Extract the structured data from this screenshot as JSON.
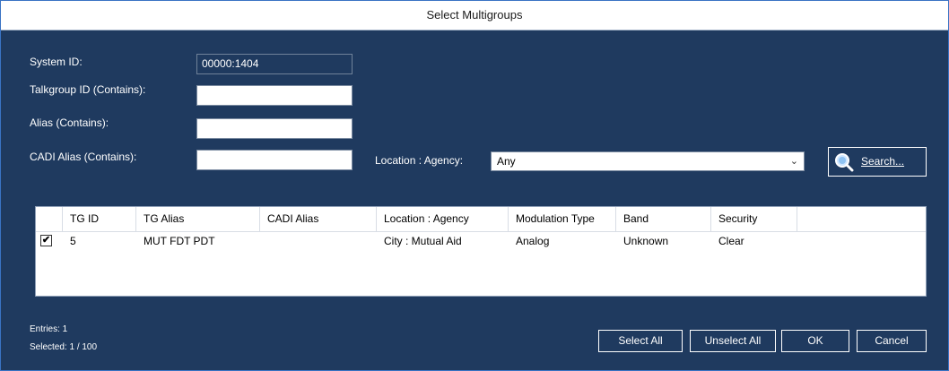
{
  "window": {
    "title": "Select Multigroups"
  },
  "form": {
    "system_id_label": "System ID:",
    "system_id_value": "00000:1404",
    "talkgroup_label": "Talkgroup ID (Contains):",
    "talkgroup_value": "",
    "alias_label": "Alias (Contains):",
    "alias_value": "",
    "cadi_label": "CADI Alias (Contains):",
    "cadi_value": "",
    "location_label": "Location : Agency:",
    "location_selected": "Any",
    "search_label": "Search..."
  },
  "grid": {
    "columns": [
      "TG ID",
      "TG Alias",
      "CADI Alias",
      "Location : Agency",
      "Modulation Type",
      "Band",
      "Security"
    ],
    "rows": [
      {
        "checked": true,
        "tg_id": "5",
        "tg_alias": "MUT FDT PDT",
        "cadi_alias": "",
        "location": "City : Mutual Aid",
        "modulation": "Analog",
        "band": "Unknown",
        "security": "Clear"
      }
    ]
  },
  "status": {
    "entries": "Entries: 1",
    "selected": "Selected: 1 / 100"
  },
  "buttons": {
    "select_all": "Select All",
    "unselect_all": "Unselect All",
    "ok": "OK",
    "cancel": "Cancel"
  }
}
